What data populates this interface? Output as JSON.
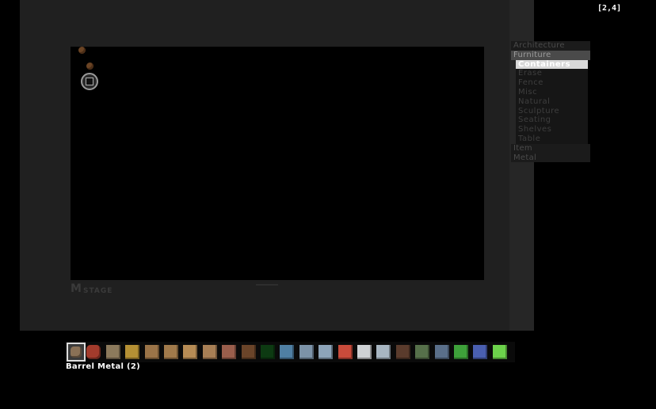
{
  "hud": {
    "coords": "[2,4]"
  },
  "logo": {
    "main": "M",
    "sub": "STAGE"
  },
  "menu": {
    "categories_top": [
      {
        "label": "Architecture",
        "active": false
      },
      {
        "label": "Furniture",
        "active": true
      }
    ],
    "subcategories": [
      {
        "label": "Containers",
        "active": true
      },
      {
        "label": "Erase",
        "active": false
      },
      {
        "label": "Fence",
        "active": false
      },
      {
        "label": "Misc",
        "active": false
      },
      {
        "label": "Natural",
        "active": false
      },
      {
        "label": "Sculpture",
        "active": false
      },
      {
        "label": "Seating",
        "active": false
      },
      {
        "label": "Shelves",
        "active": false
      },
      {
        "label": "Table",
        "active": false
      }
    ],
    "categories_bottom": [
      {
        "label": "Item",
        "active": false
      },
      {
        "label": "Metal",
        "active": false
      }
    ]
  },
  "hotbar": {
    "selected_name": "Barrel Metal (2)",
    "slots": [
      {
        "icon": "barrel-metal-icon",
        "color": "#8a7156",
        "selected": true
      },
      {
        "icon": "barrel-red-icon",
        "color": "#a33b2c"
      },
      {
        "icon": "crate-light-icon",
        "color": "#8c7a5c"
      },
      {
        "icon": "crate-gold-icon",
        "color": "#b59034"
      },
      {
        "icon": "plank-wall-icon",
        "color": "#9b7448"
      },
      {
        "icon": "plank-wall-icon",
        "color": "#a17a4b"
      },
      {
        "icon": "wood-panel-icon",
        "color": "#b78c55"
      },
      {
        "icon": "wood-panel-icon",
        "color": "#a87f55"
      },
      {
        "icon": "brick-panel-icon",
        "color": "#9a5e4c"
      },
      {
        "icon": "small-crate-icon",
        "color": "#6a4429"
      },
      {
        "icon": "green-dots-icon",
        "color": "#0d3a12"
      },
      {
        "icon": "glass-blue-icon",
        "color": "#4f7fa3"
      },
      {
        "icon": "window-icon",
        "color": "#7c93a8"
      },
      {
        "icon": "glass-panel-icon",
        "color": "#8da4b9"
      },
      {
        "icon": "red-panel-icon",
        "color": "#c94b3b"
      },
      {
        "icon": "white-slab-icon",
        "color": "#cfd2d5"
      },
      {
        "icon": "light-panel-icon",
        "color": "#a8b6c2"
      },
      {
        "icon": "dark-wood-icon",
        "color": "#5a3b2c"
      },
      {
        "icon": "green-wood-icon",
        "color": "#56704a"
      },
      {
        "icon": "blue-wood-icon",
        "color": "#5a6f8a"
      },
      {
        "icon": "green-block-icon",
        "color": "#3ea13a"
      },
      {
        "icon": "blue-tool-icon",
        "color": "#4a5fb0"
      },
      {
        "icon": "green-tool-icon",
        "color": "#6cd24b"
      }
    ]
  }
}
